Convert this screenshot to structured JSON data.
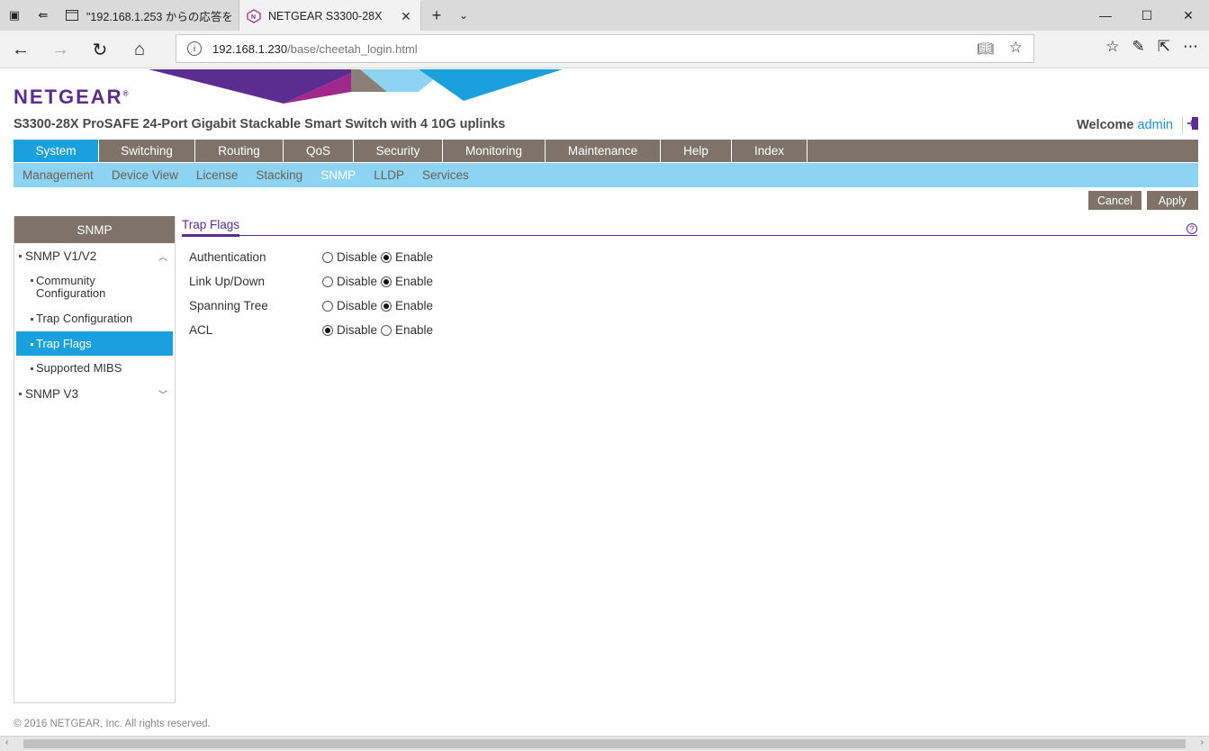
{
  "browser": {
    "tabs": [
      {
        "title": "\"192.168.1.253 からの応答を",
        "active": false
      },
      {
        "title": "NETGEAR S3300-28X",
        "active": true
      }
    ],
    "url_host": "192.168.1.230",
    "url_path": "/base/cheetah_login.html"
  },
  "header": {
    "logo": "NETGEAR",
    "logo_mark": "®",
    "product": "S3300-28X ProSAFE 24-Port Gigabit Stackable Smart Switch with 4 10G uplinks",
    "welcome": "Welcome",
    "user": "admin"
  },
  "main_nav": [
    {
      "label": "System",
      "active": true
    },
    {
      "label": "Switching",
      "active": false
    },
    {
      "label": "Routing",
      "active": false
    },
    {
      "label": "QoS",
      "active": false
    },
    {
      "label": "Security",
      "active": false
    },
    {
      "label": "Monitoring",
      "active": false
    },
    {
      "label": "Maintenance",
      "active": false
    },
    {
      "label": "Help",
      "active": false
    },
    {
      "label": "Index",
      "active": false
    }
  ],
  "sub_nav": [
    {
      "label": "Management",
      "active": false
    },
    {
      "label": "Device View",
      "active": false
    },
    {
      "label": "License",
      "active": false
    },
    {
      "label": "Stacking",
      "active": false
    },
    {
      "label": "SNMP",
      "active": true
    },
    {
      "label": "LLDP",
      "active": false
    },
    {
      "label": "Services",
      "active": false
    }
  ],
  "actions": {
    "cancel": "Cancel",
    "apply": "Apply"
  },
  "sidebar": {
    "title": "SNMP",
    "groups": [
      {
        "label": "SNMP V1/V2",
        "expanded": true
      },
      {
        "label": "SNMP V3",
        "expanded": false
      }
    ],
    "items": [
      {
        "label": "Community Configuration",
        "active": false
      },
      {
        "label": "Trap Configuration",
        "active": false
      },
      {
        "label": "Trap Flags",
        "active": true
      },
      {
        "label": "Supported MIBS",
        "active": false
      }
    ]
  },
  "content": {
    "section_title": "Trap Flags",
    "option_disable": "Disable",
    "option_enable": "Enable",
    "rows": [
      {
        "label": "Authentication",
        "value": "Enable"
      },
      {
        "label": "Link Up/Down",
        "value": "Enable"
      },
      {
        "label": "Spanning Tree",
        "value": "Enable"
      },
      {
        "label": "ACL",
        "value": "Disable"
      }
    ]
  },
  "footer": "© 2016 NETGEAR, Inc. All rights reserved.",
  "colors": {
    "brand_purple": "#5b2d90",
    "nav_brown": "#7f7369",
    "active_blue": "#1aa0dd",
    "subnav_blue": "#8dd3f2"
  }
}
